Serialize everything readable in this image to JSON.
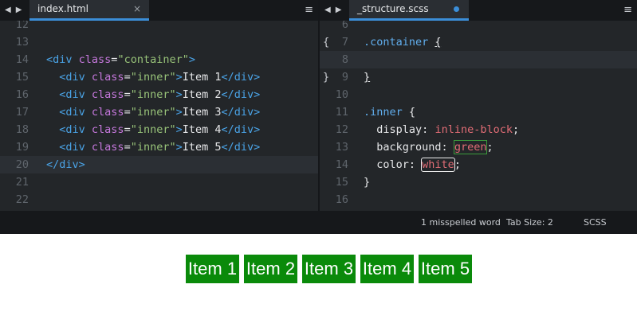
{
  "left_pane": {
    "tab_title": "index.html",
    "close_icon": "×",
    "lines": [
      {
        "num": "12",
        "html": ""
      },
      {
        "num": "13",
        "html": ""
      },
      {
        "num": "14",
        "html": "<span class='t'>&lt;div</span> <span class='a'>class</span><span class='p'>=</span><span class='s'>\"container\"</span><span class='t'>&gt;</span>"
      },
      {
        "num": "15",
        "html": "  <span class='t'>&lt;div</span> <span class='a'>class</span><span class='p'>=</span><span class='s'>\"inner\"</span><span class='t'>&gt;</span>Item 1<span class='t'>&lt;/div&gt;</span>"
      },
      {
        "num": "16",
        "html": "  <span class='t'>&lt;div</span> <span class='a'>class</span><span class='p'>=</span><span class='s'>\"inner\"</span><span class='t'>&gt;</span>Item 2<span class='t'>&lt;/div&gt;</span>"
      },
      {
        "num": "17",
        "html": "  <span class='t'>&lt;div</span> <span class='a'>class</span><span class='p'>=</span><span class='s'>\"inner\"</span><span class='t'>&gt;</span>Item 3<span class='t'>&lt;/div&gt;</span>"
      },
      {
        "num": "18",
        "html": "  <span class='t'>&lt;div</span> <span class='a'>class</span><span class='p'>=</span><span class='s'>\"inner\"</span><span class='t'>&gt;</span>Item 4<span class='t'>&lt;/div&gt;</span>"
      },
      {
        "num": "19",
        "html": "  <span class='t'>&lt;div</span> <span class='a'>class</span><span class='p'>=</span><span class='s'>\"inner\"</span><span class='t'>&gt;</span>Item 5<span class='t'>&lt;/div&gt;</span>"
      },
      {
        "num": "20",
        "html": "<span class='t'>&lt;/div&gt;</span>",
        "active": true
      },
      {
        "num": "21",
        "html": ""
      },
      {
        "num": "22",
        "html": ""
      }
    ]
  },
  "right_pane": {
    "tab_title": "_structure.scss",
    "lines": [
      {
        "num": "6",
        "html": ""
      },
      {
        "num": "7",
        "fold": "{",
        "html": "<span class='sel'>.container</span> <span class='u'>{</span>"
      },
      {
        "num": "8",
        "html": "",
        "active": true
      },
      {
        "num": "9",
        "fold": "}",
        "html": "<span class='u'>}</span>"
      },
      {
        "num": "10",
        "html": ""
      },
      {
        "num": "11",
        "html": "<span class='sel'>.inner</span> {"
      },
      {
        "num": "12",
        "html": "  <span class='prop'>display</span>: <span class='val'>inline-block</span>;"
      },
      {
        "num": "13",
        "html": "  <span class='prop'>background</span>: <span class='val spell-g'>green</span>;"
      },
      {
        "num": "14",
        "html": "  <span class='prop'>color</span>: <span class='val spell-w'>white</span>;"
      },
      {
        "num": "15",
        "html": "}"
      },
      {
        "num": "16",
        "html": ""
      }
    ]
  },
  "status_bar": {
    "spelling": "1 misspelled word",
    "tab_size": "Tab Size: 2",
    "syntax": "SCSS"
  },
  "preview_items": [
    "Item 1",
    "Item 2",
    "Item 3",
    "Item 4",
    "Item 5"
  ],
  "colors": {
    "item_background": "#0a8a0a",
    "accent": "#3b8ed8"
  },
  "icons": {
    "nav": [
      "◀",
      "▶"
    ],
    "menu": "≡"
  }
}
